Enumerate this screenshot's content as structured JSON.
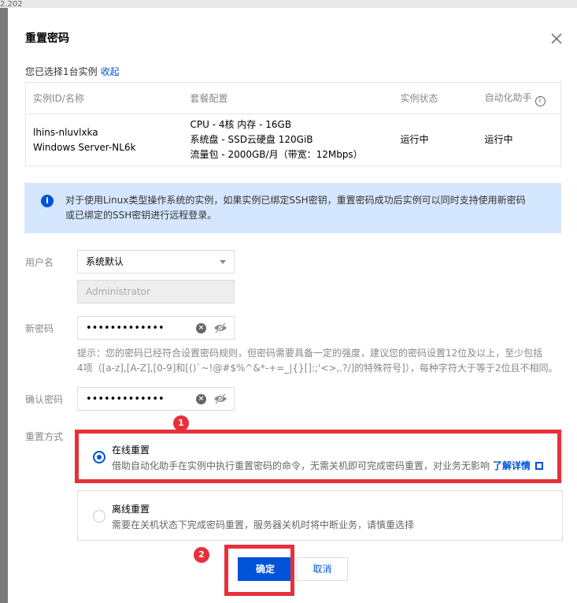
{
  "background": {
    "fragment_text": "2.202",
    "accent_color": "#7a7a7a"
  },
  "dialog": {
    "title": "重置密码",
    "selected_text": "您已选择1台实例",
    "collapse_link": "收起"
  },
  "instance_table": {
    "headers": [
      "实例ID/名称",
      "套餐配置",
      "实例状态",
      "自动化助手"
    ],
    "rows": [
      {
        "id": "lhins-nluvlxka",
        "name": "Windows Server-NL6k",
        "config": [
          "CPU - 4核 内存 - 16GB",
          "系统盘 - SSD云硬盘 120GiB",
          "流量包 - 2000GB/月（带宽：12Mbps）"
        ],
        "status": "运行中",
        "agent_status": "运行中"
      }
    ]
  },
  "notice": {
    "lines": [
      "对于使用Linux类型操作系统的实例，如果实例已绑定SSH密钥，重置密码成功后实例可以同时支持使用新密码",
      "或已绑定的SSH密钥进行远程登录。"
    ]
  },
  "form": {
    "username_label": "用户名",
    "username_select": "系统默认",
    "username_value": "Administrator",
    "new_password_label": "新密码",
    "new_password_value": "•••••••••••••",
    "hint_lines": [
      "提示：您的密码已经符合设置密码规则，但密码需要具备一定的强度，建议您的密码设置12位及以上，至少包括",
      "4项（[a-z],[A-Z],[0-9]和[()`~!@#$%^&*-+=_|{}[]:;'<>,.?/]的特殊符号]），每种字符大于等于2位且不相同。"
    ],
    "confirm_password_label": "确认密码",
    "confirm_password_value": "•••••••••••••",
    "reset_method_label": "重置方式"
  },
  "options": [
    {
      "title": "在线重置",
      "desc": "借助自动化助手在实例中执行重置密码的命令，无需关机即可完成密码重置，对业务无影响",
      "link": "了解详情",
      "selected": true
    },
    {
      "title": "离线重置",
      "desc": "需要在关机状态下完成密码重置，服务器关机时将中断业务，请慎重选择",
      "selected": false
    }
  ],
  "annotations": {
    "badge1": "1",
    "badge2": "2",
    "color": "#e8303a"
  },
  "buttons": {
    "confirm": "确定",
    "cancel": "取消"
  },
  "colors": {
    "primary": "#0052d9",
    "running": "#0abf5b",
    "notice_bg": "#d5e7ff"
  }
}
